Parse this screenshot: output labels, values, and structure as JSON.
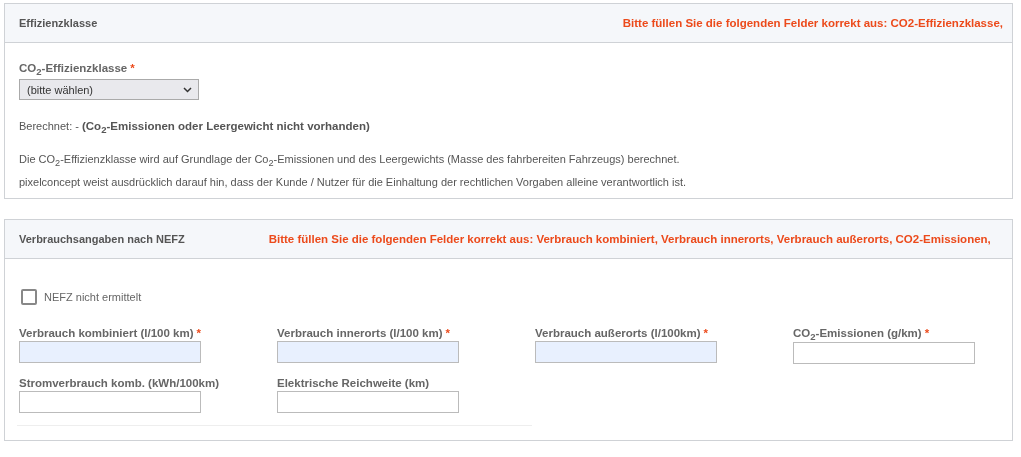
{
  "efficiency_section": {
    "title": "Effizienzklasse",
    "error": "Bitte füllen Sie die folgenden Felder korrekt aus: CO2-Effizienzklasse,",
    "select_field": {
      "label": "CO$_{2}$-Effizienzklasse",
      "required_mark": "*",
      "value": "(bitte wählen)"
    },
    "computed_label": "Berechnet: -",
    "computed_value": "(Co$_{2}$-Emissionen oder Leergewicht nicht vorhanden)",
    "notes": [
      "Die CO$_{2}$-Effizienzklasse wird auf Grundlage der Co$_{2}$-Emissionen und des Leergewichts (Masse des fahrbereiten Fahrzeugs) berechnet.",
      "pixelconcept weist ausdrücklich darauf hin, dass der Kunde / Nutzer für die Einhaltung der rechtlichen Vorgaben alleine verantwortlich ist."
    ]
  },
  "consumption_section": {
    "title": "Verbrauchsangaben nach NEFZ",
    "error": "Bitte füllen Sie die folgenden Felder korrekt aus: Verbrauch kombiniert, Verbrauch innerorts, Verbrauch außerorts, CO2-Emissionen,",
    "checkbox": {
      "label": "NEFZ nicht ermittelt",
      "checked": false
    },
    "fields": [
      {
        "label": "Verbrauch kombiniert (l/100 km)",
        "required_mark": "*",
        "highlighted": true
      },
      {
        "label": "Verbrauch innerorts (l/100 km)",
        "required_mark": "*",
        "highlighted": true
      },
      {
        "label": "Verbrauch außerorts (l/100km)",
        "required_mark": "*",
        "highlighted": true
      },
      {
        "label": "CO$_{2}$-Emissionen (g/km)",
        "required_mark": "*",
        "highlighted": false
      },
      {
        "label": "Stromverbrauch komb. (kWh/100km)",
        "highlighted": false
      },
      {
        "label": "Elektrische Reichweite (km)",
        "highlighted": false
      }
    ]
  }
}
